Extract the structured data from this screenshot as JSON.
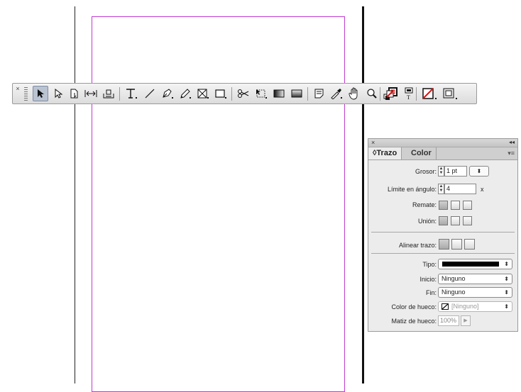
{
  "toolbar": {
    "close_glyph": "×",
    "tools": [
      {
        "name": "selection-tool-icon",
        "glyph": "➤",
        "active": true
      },
      {
        "name": "direct-selection-tool-icon",
        "glyph": "↖"
      },
      {
        "name": "page-tool-icon",
        "glyph": "🗋"
      },
      {
        "name": "gap-tool-icon",
        "glyph": "↔"
      },
      {
        "name": "content-collector-tool-icon",
        "glyph": "⌂"
      },
      {
        "name": "type-tool-icon",
        "glyph": "T."
      },
      {
        "name": "line-tool-icon",
        "glyph": "╱"
      },
      {
        "name": "pen-tool-icon",
        "glyph": "✒"
      },
      {
        "name": "pencil-tool-icon",
        "glyph": "✎"
      },
      {
        "name": "rectangle-frame-tool-icon",
        "glyph": "⊠"
      },
      {
        "name": "rectangle-tool-icon",
        "glyph": "▭"
      },
      {
        "name": "scissors-tool-icon",
        "glyph": "✂"
      },
      {
        "name": "free-transform-tool-icon",
        "glyph": "⬚"
      },
      {
        "name": "gradient-swatch-tool-icon",
        "glyph": "▬"
      },
      {
        "name": "gradient-feather-tool-icon",
        "glyph": "▭"
      },
      {
        "name": "note-tool-icon",
        "glyph": "🗊"
      },
      {
        "name": "eyedropper-tool-icon",
        "glyph": "✐"
      },
      {
        "name": "hand-tool-icon",
        "glyph": "✋"
      },
      {
        "name": "zoom-tool-icon",
        "glyph": "🔍"
      },
      {
        "name": "default-fill-stroke-icon",
        "glyph": "◩"
      },
      {
        "name": "formatting-affects-container-icon",
        "glyph": "▣"
      },
      {
        "name": "formatting-affects-text-icon",
        "glyph": "T"
      },
      {
        "name": "apply-none-icon",
        "glyph": "⧄"
      },
      {
        "name": "normal-view-mode-icon",
        "glyph": "▣"
      }
    ]
  },
  "panel": {
    "close_glyph": "×",
    "collapse_glyph": "◂◂",
    "menu_glyph": "▾≡",
    "tabs": {
      "active": "◊Trazo",
      "inactive": "Color"
    },
    "grosor": {
      "label": "Grosor:",
      "value": "1 pt",
      "dropdown": "⬍"
    },
    "limite": {
      "label": "Límite en ángulo:",
      "value": "4",
      "suffix": "x"
    },
    "remate": {
      "label": "Remate:"
    },
    "union": {
      "label": "Unión:"
    },
    "alinear": {
      "label": "Alinear trazo:"
    },
    "tipo": {
      "label": "Tipo:"
    },
    "inicio": {
      "label": "Inicio:",
      "value": "Ninguno"
    },
    "fin": {
      "label": "Fin:",
      "value": "Ninguno"
    },
    "color_hueco": {
      "label": "Color de hueco:",
      "value": "[Ninguno]"
    },
    "matiz_hueco": {
      "label": "Matiz de hueco:",
      "value": "100%"
    },
    "select_arrow": "⬍"
  }
}
